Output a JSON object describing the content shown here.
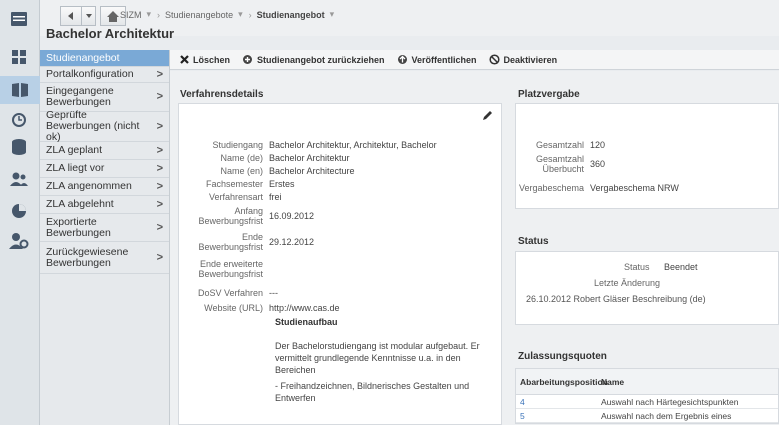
{
  "topbar": {
    "crumbs": [
      "SIZM",
      "Studienangebote",
      "Studienangebot"
    ],
    "app_title": "Bachelor Architektur"
  },
  "rail": {
    "icons": [
      "home-icon",
      "apps-grid-icon",
      "book-icon",
      "alarm-clock-icon",
      "database-icon",
      "users-icon",
      "pie-chart-icon",
      "person-settings-icon"
    ]
  },
  "sidebar": {
    "items": [
      {
        "label": "Studienangebot",
        "active": true
      },
      {
        "label": "Portalkonfiguration",
        "chevron": ">"
      },
      {
        "label": "Eingegangene Bewerbungen",
        "chevron": ">"
      },
      {
        "label": "Geprüfte Bewerbungen (nicht ok)",
        "chevron": ">"
      },
      {
        "label": "ZLA geplant",
        "chevron": ">"
      },
      {
        "label": "ZLA liegt vor",
        "chevron": ">"
      },
      {
        "label": "ZLA angenommen",
        "chevron": ">"
      },
      {
        "label": "ZLA abgelehnt",
        "chevron": ">"
      },
      {
        "label": "Exportierte Bewerbungen",
        "chevron": ">"
      },
      {
        "label": "Zurückgewiesene Bewerbungen",
        "chevron": ">"
      }
    ]
  },
  "toolbar": {
    "delete_label": "Löschen",
    "withdraw_label": "Studienangebot zurückziehen",
    "publish_label": "Veröffentlichen",
    "deactivate_label": "Deaktivieren"
  },
  "verfahren": {
    "title": "Verfahrensdetails",
    "rows": [
      {
        "key": "Studiengang",
        "value": "Bachelor Architektur, Architektur, Bachelor"
      },
      {
        "key": "Name (de)",
        "value": "Bachelor Architektur"
      },
      {
        "key": "Name (en)",
        "value": "Bachelor Architecture"
      },
      {
        "key": "Fachsemester",
        "value": "Erstes"
      },
      {
        "key": "Verfahrensart",
        "value": "frei"
      },
      {
        "key": "Anfang Bewerbungsfrist",
        "value": "16.09.2012"
      },
      {
        "key": "Ende Bewerbungsfrist",
        "value": "29.12.2012"
      },
      {
        "key": "Ende erweiterte Bewerbungsfrist",
        "value": ""
      },
      {
        "key": "DoSV Verfahren",
        "value": "---"
      },
      {
        "key": "Website (URL)",
        "value": "http://www.cas.de"
      }
    ],
    "studienaufbau_label": "Studienaufbau",
    "studienaufbau_text": "Der Bachelorstudiengang ist modular aufgebaut. Er vermittelt grundlegende Kenntnisse u.a. in den Bereichen",
    "bullet1": "- Freihandzeichnen, Bildnerisches Gestalten und Entwerfen"
  },
  "platz": {
    "title": "Platzvergabe",
    "rows": [
      {
        "key": "Gesamtzahl",
        "value": "120"
      },
      {
        "key": "Gesamtzahl Überbucht",
        "value": "360"
      },
      {
        "key": "Vergabeschema",
        "value": "Vergabeschema NRW"
      }
    ]
  },
  "status": {
    "title": "Status",
    "status_key": "Status",
    "status_value": "Beendet",
    "last_change_label": "Letzte Änderung",
    "last_change_value": "26.10.2012 Robert Gläser Beschreibung (de)"
  },
  "quoten": {
    "title": "Zulassungsquoten",
    "headers": [
      "Abarbeitungsposition",
      "Name"
    ],
    "rows": [
      {
        "pos": "4",
        "name": "Auswahl nach Härtegesichtspunkten"
      },
      {
        "pos": "5",
        "name": "Auswahl nach dem Ergebnis eines"
      }
    ]
  },
  "colors": {
    "active_sidebar": "#7aa9d6",
    "link": "#3b73b9"
  }
}
